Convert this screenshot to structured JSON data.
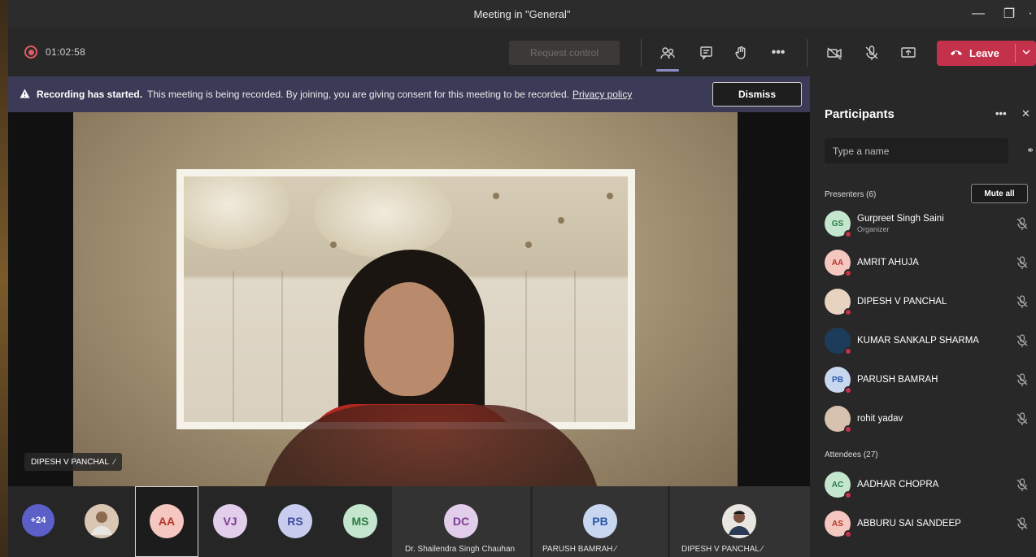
{
  "window": {
    "title": "Meeting in \"General\""
  },
  "toolbar": {
    "timer": "01:02:58",
    "request_control": "Request control",
    "leave_label": "Leave"
  },
  "banner": {
    "bold": "Recording has started.",
    "message": "This meeting is being recorded. By joining, you are giving consent for this meeting to be recorded.",
    "link": "Privacy policy",
    "dismiss": "Dismiss"
  },
  "stage": {
    "speaker_name": "DIPESH V PANCHAL"
  },
  "roster": {
    "overflow": "+24",
    "tiles": [
      {
        "initials": "AA",
        "bg": "#f4c7c0",
        "fg": "#b5342a"
      },
      {
        "initials": "VJ",
        "bg": "#e2cdeb",
        "fg": "#7a3d8f"
      },
      {
        "initials": "RS",
        "bg": "#c8cdf0",
        "fg": "#3d4a9e"
      },
      {
        "initials": "MS",
        "bg": "#c4e6cf",
        "fg": "#2b7a45"
      }
    ],
    "wide_tiles": [
      {
        "initials": "DC",
        "label": "Dr. Shailendra Singh Chauhan",
        "bg": "#e2cdeb",
        "fg": "#7a3d8f"
      },
      {
        "initials": "PB",
        "label": "PARUSH BAMRAH",
        "bg": "#c8d6f0",
        "fg": "#2a58a8"
      },
      {
        "initials": "",
        "label": "DIPESH V PANCHAL"
      }
    ]
  },
  "participants": {
    "title": "Participants",
    "search_placeholder": "Type a name",
    "presenters_label": "Presenters (6)",
    "mute_all": "Mute all",
    "attendees_label": "Attendees (27)",
    "presenters": [
      {
        "initials": "GS",
        "name": "Gurpreet Singh Saini",
        "role": "Organizer",
        "bg": "#c4e6cf",
        "fg": "#2b7a45"
      },
      {
        "initials": "AA",
        "name": "AMRIT AHUJA",
        "role": "",
        "bg": "#f4c7c0",
        "fg": "#b5342a"
      },
      {
        "initials": "",
        "name": "DIPESH V PANCHAL",
        "role": "",
        "bg": "#e8d2c0",
        "fg": "#333"
      },
      {
        "initials": "",
        "name": "KUMAR SANKALP SHARMA",
        "role": "",
        "bg": "#1d3c5c",
        "fg": "#fff"
      },
      {
        "initials": "PB",
        "name": "PARUSH BAMRAH",
        "role": "",
        "bg": "#c8d6f0",
        "fg": "#2a58a8"
      },
      {
        "initials": "",
        "name": "rohit yadav",
        "role": "",
        "bg": "#d6c2ae",
        "fg": "#333"
      }
    ],
    "attendees": [
      {
        "initials": "AC",
        "name": "AADHAR CHOPRA",
        "bg": "#c4e6cf",
        "fg": "#2b7a45"
      },
      {
        "initials": "AS",
        "name": "ABBURU SAI SANDEEP",
        "bg": "#f4c7c0",
        "fg": "#b5342a"
      }
    ]
  },
  "colors": {
    "leave": "#c4314b",
    "banner": "#3c3b57",
    "accent": "#8b8cc7"
  }
}
